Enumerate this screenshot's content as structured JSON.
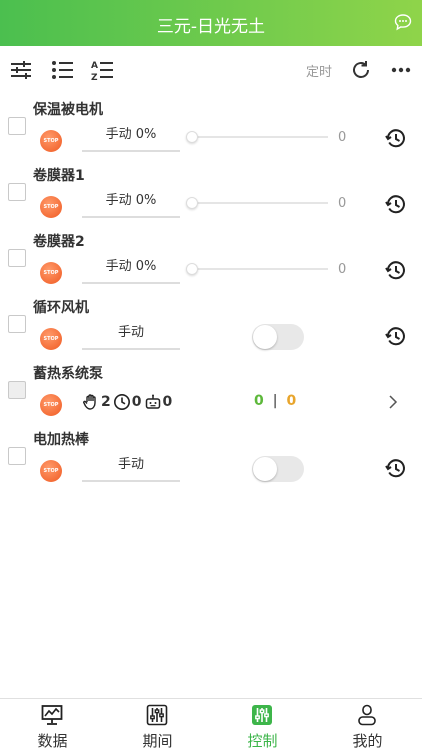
{
  "header": {
    "title": "三元-日光无土",
    "chat_icon": "chat-bubble-icon"
  },
  "toolbar": {
    "filter_icon": "sliders-icon",
    "list_icon": "list-icon",
    "sort_icon": "sort-az-icon",
    "schedule_label": "定时",
    "refresh_icon": "refresh-icon",
    "more_icon": "more-dots-icon"
  },
  "devices": [
    {
      "name": "保温被电机",
      "stop_label": "STOP",
      "mode": "手动 0%",
      "slider_value": "0",
      "control": "slider"
    },
    {
      "name": "卷膜器1",
      "stop_label": "STOP",
      "mode": "手动 0%",
      "slider_value": "0",
      "control": "slider"
    },
    {
      "name": "卷膜器2",
      "stop_label": "STOP",
      "mode": "手动 0%",
      "slider_value": "0",
      "control": "slider"
    },
    {
      "name": "循环风机",
      "stop_label": "STOP",
      "mode": "手动",
      "control": "toggle",
      "toggle_on": false
    },
    {
      "name": "蓄热系统泵",
      "stop_label": "STOP",
      "control": "group",
      "manual_count": "2",
      "timer_count": "0",
      "auto_count": "0",
      "on_count": "0",
      "separator": "|",
      "off_count": "0"
    },
    {
      "name": "电加热棒",
      "stop_label": "STOP",
      "mode": "手动",
      "control": "toggle",
      "toggle_on": false
    }
  ],
  "tabs": [
    {
      "label": "数据",
      "icon": "monitor-chart-icon",
      "active": false
    },
    {
      "label": "期间",
      "icon": "sliders-box-icon",
      "active": false
    },
    {
      "label": "控制",
      "icon": "control-sliders-icon",
      "active": true
    },
    {
      "label": "我的",
      "icon": "user-icon",
      "active": false
    }
  ],
  "colors": {
    "brand_green": "#3db54a",
    "stop_orange": "#f05a22",
    "count_green": "#5db83b",
    "count_orange": "#e8a52c"
  }
}
